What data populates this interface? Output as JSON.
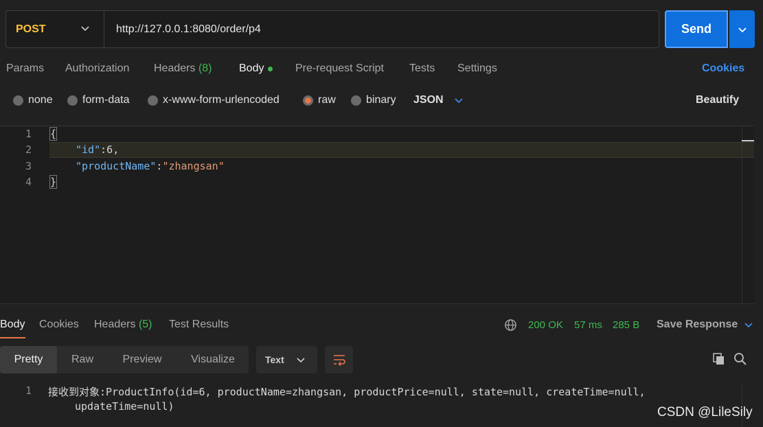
{
  "request": {
    "method": "POST",
    "url": "http://127.0.0.1:8080/order/p4",
    "send_label": "Send"
  },
  "request_tabs": {
    "params": "Params",
    "authorization": "Authorization",
    "headers": "Headers",
    "headers_count": "(8)",
    "body": "Body",
    "prerequest": "Pre-request Script",
    "tests": "Tests",
    "settings": "Settings",
    "cookies": "Cookies"
  },
  "body_types": {
    "none": "none",
    "form_data": "form-data",
    "urlencoded": "x-www-form-urlencoded",
    "raw": "raw",
    "binary": "binary",
    "format": "JSON",
    "beautify": "Beautify",
    "selected": "raw"
  },
  "editor": {
    "line_numbers": [
      "1",
      "2",
      "3",
      "4"
    ],
    "open_brace": "{",
    "close_brace": "}",
    "id_key": "\"id\"",
    "id_value": "6",
    "name_key": "\"productName\"",
    "name_value": "\"zhangsan\"",
    "colon": ":",
    "comma": ","
  },
  "response_tabs": {
    "body": "Body",
    "cookies": "Cookies",
    "headers": "Headers",
    "headers_count": "(5)",
    "test_results": "Test Results"
  },
  "response_status": {
    "code": "200 OK",
    "time": "57 ms",
    "size": "285 B",
    "save": "Save Response"
  },
  "view_modes": {
    "pretty": "Pretty",
    "raw": "Raw",
    "preview": "Preview",
    "visualize": "Visualize",
    "format": "Text"
  },
  "response_body": {
    "line_number": "1",
    "line1": "接收到对象:ProductInfo(id=6, productName=zhangsan, productPrice=null, state=null, createTime=null,",
    "line2": "updateTime=null)"
  },
  "watermark": "CSDN @LileSily",
  "colors": {
    "accent": "#0f6fdc",
    "method": "#ffc23a",
    "success": "#3fb950",
    "active_tab": "#e8744a"
  }
}
